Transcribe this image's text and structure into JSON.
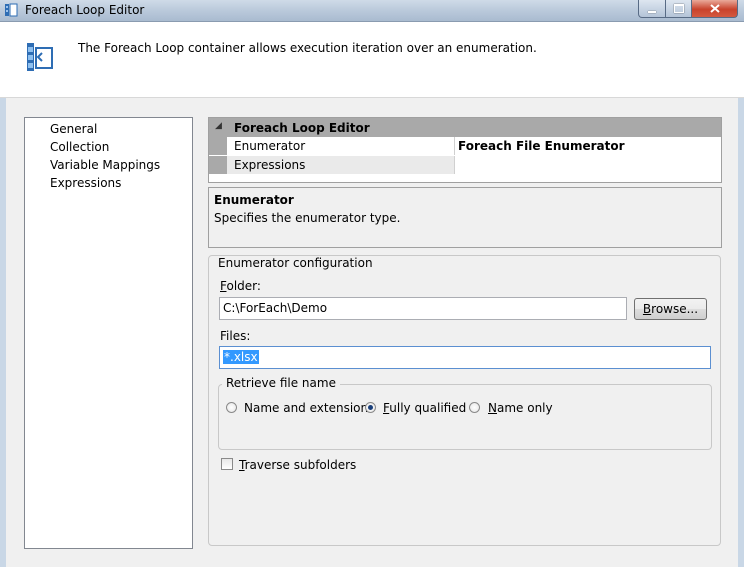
{
  "window": {
    "title": "Foreach Loop Editor"
  },
  "header": {
    "description": "The Foreach Loop container allows execution iteration over an enumeration."
  },
  "nav": {
    "items": [
      "General",
      "Collection",
      "Variable Mappings",
      "Expressions"
    ],
    "selected": "Collection"
  },
  "grid": {
    "category": "Foreach Loop Editor",
    "rows": [
      {
        "name": "Enumerator",
        "value": "Foreach File Enumerator"
      },
      {
        "name": "Expressions",
        "value": ""
      }
    ]
  },
  "description": {
    "title": "Enumerator",
    "text": "Specifies the enumerator type."
  },
  "config": {
    "legend": "Enumerator configuration",
    "folder_label_ul": "F",
    "folder_label_rest": "older:",
    "folder_value": "C:\\ForEach\\Demo",
    "browse_ul": "B",
    "browse_rest": "rowse...",
    "files_label": "Files:",
    "files_value": "*.xlsx",
    "retrieve_legend": "Retrieve file name",
    "radios": [
      {
        "label": "Name and extension",
        "checked": false
      },
      {
        "label_ul": "F",
        "label_rest": "ully qualified",
        "checked": true
      },
      {
        "label_ul": "N",
        "label_rest": "ame only",
        "checked": false
      }
    ],
    "traverse_ul": "T",
    "traverse_rest": "raverse subfolders",
    "traverse_checked": false
  },
  "colors": {
    "selection": "#3399ff",
    "grid_category": "#a9a9a9",
    "window_bg": "#f0f0f0"
  }
}
